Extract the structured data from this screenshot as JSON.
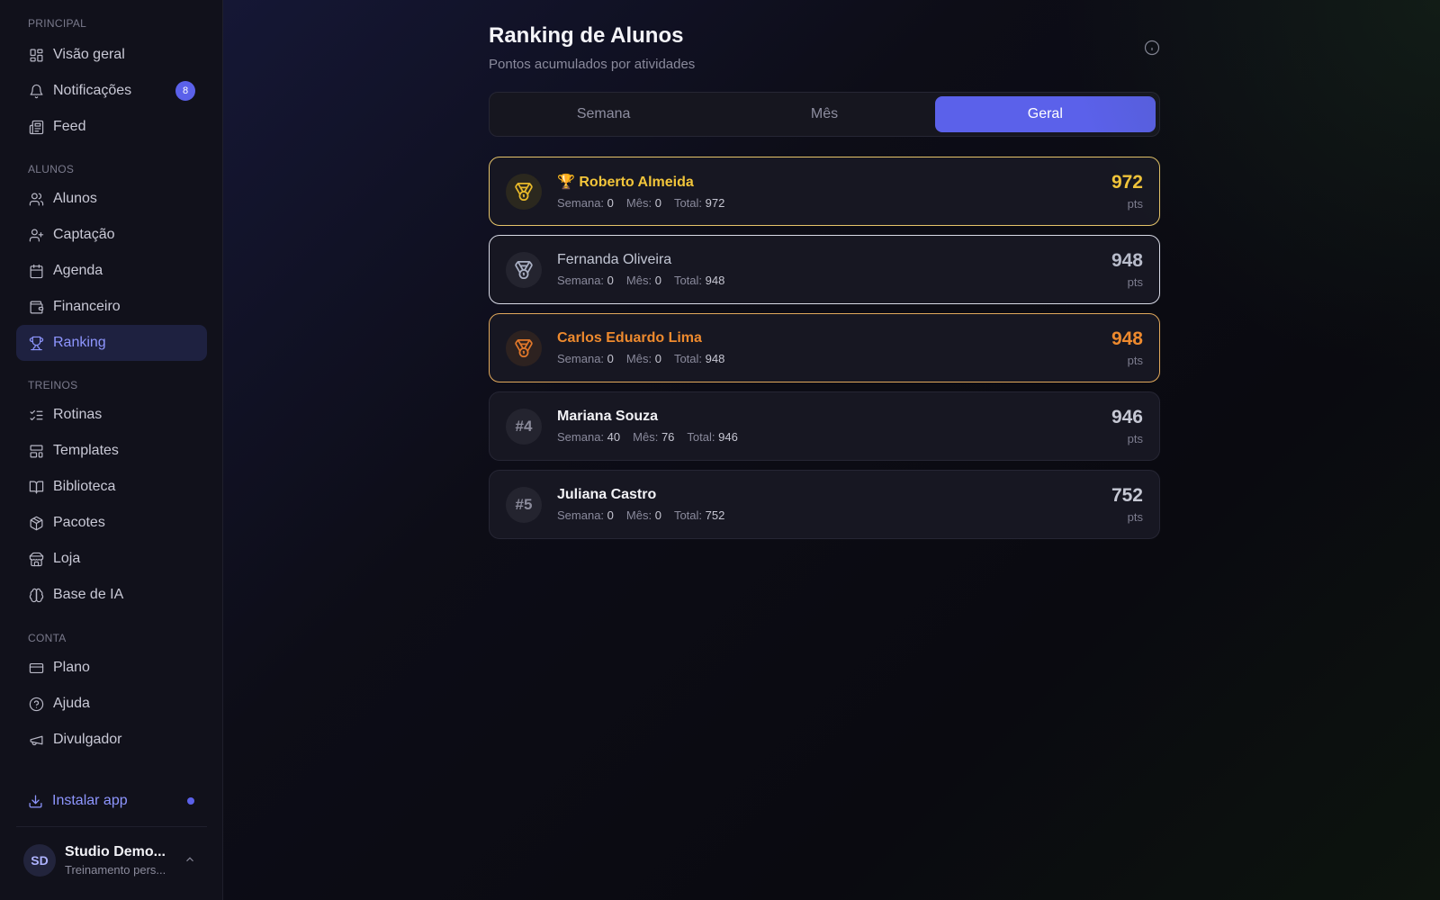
{
  "sidebar": {
    "sections": {
      "principal": "PRINCIPAL",
      "alunos": "ALUNOS",
      "treinos": "TREINOS",
      "conta": "CONTA"
    },
    "items": [
      {
        "label": "Visão geral",
        "icon": "grid-icon"
      },
      {
        "label": "Notificações",
        "icon": "bell-icon",
        "badge": "8"
      },
      {
        "label": "Feed",
        "icon": "newspaper-icon"
      },
      {
        "label": "Alunos",
        "icon": "users-icon"
      },
      {
        "label": "Captação",
        "icon": "user-plus-icon"
      },
      {
        "label": "Agenda",
        "icon": "calendar-icon"
      },
      {
        "label": "Financeiro",
        "icon": "wallet-icon"
      },
      {
        "label": "Ranking",
        "icon": "trophy-icon",
        "active": true
      },
      {
        "label": "Rotinas",
        "icon": "list-check-icon"
      },
      {
        "label": "Templates",
        "icon": "layout-icon"
      },
      {
        "label": "Biblioteca",
        "icon": "book-icon"
      },
      {
        "label": "Pacotes",
        "icon": "package-icon"
      },
      {
        "label": "Loja",
        "icon": "store-icon"
      },
      {
        "label": "Base de IA",
        "icon": "brain-icon"
      },
      {
        "label": "Plano",
        "icon": "credit-card-icon"
      },
      {
        "label": "Ajuda",
        "icon": "help-circle-icon"
      },
      {
        "label": "Divulgador",
        "icon": "megaphone-icon"
      }
    ],
    "install": "Instalar app",
    "profile": {
      "initials": "SD",
      "name": "Studio Demo...",
      "subtitle": "Treinamento pers..."
    }
  },
  "main": {
    "title": "Ranking de Alunos",
    "subtitle": "Pontos acumulados por atividades",
    "tabs": [
      {
        "label": "Semana"
      },
      {
        "label": "Mês"
      },
      {
        "label": "Geral",
        "active": true
      }
    ],
    "stat_labels": {
      "week": "Semana:",
      "month": "Mês:",
      "total": "Total:"
    },
    "pts_unit": "pts",
    "ranking": [
      {
        "rank": "",
        "name": "🏆 Roberto Almeida",
        "week": "0",
        "month": "0",
        "total": "972",
        "points": "972",
        "tier": "gold"
      },
      {
        "rank": "",
        "name": "Fernanda Oliveira",
        "week": "0",
        "month": "0",
        "total": "948",
        "points": "948",
        "tier": "silver"
      },
      {
        "rank": "",
        "name": "Carlos Eduardo Lima",
        "week": "0",
        "month": "0",
        "total": "948",
        "points": "948",
        "tier": "bronze"
      },
      {
        "rank": "#4",
        "name": "Mariana Souza",
        "week": "40",
        "month": "76",
        "total": "946",
        "points": "946",
        "tier": "none"
      },
      {
        "rank": "#5",
        "name": "Juliana Castro",
        "week": "0",
        "month": "0",
        "total": "752",
        "points": "752",
        "tier": "none"
      }
    ]
  },
  "colors": {
    "accent": "#5b61ea",
    "gold": "#f2c53a",
    "silver": "#d8dae6",
    "bronze": "#ee8a2e"
  }
}
